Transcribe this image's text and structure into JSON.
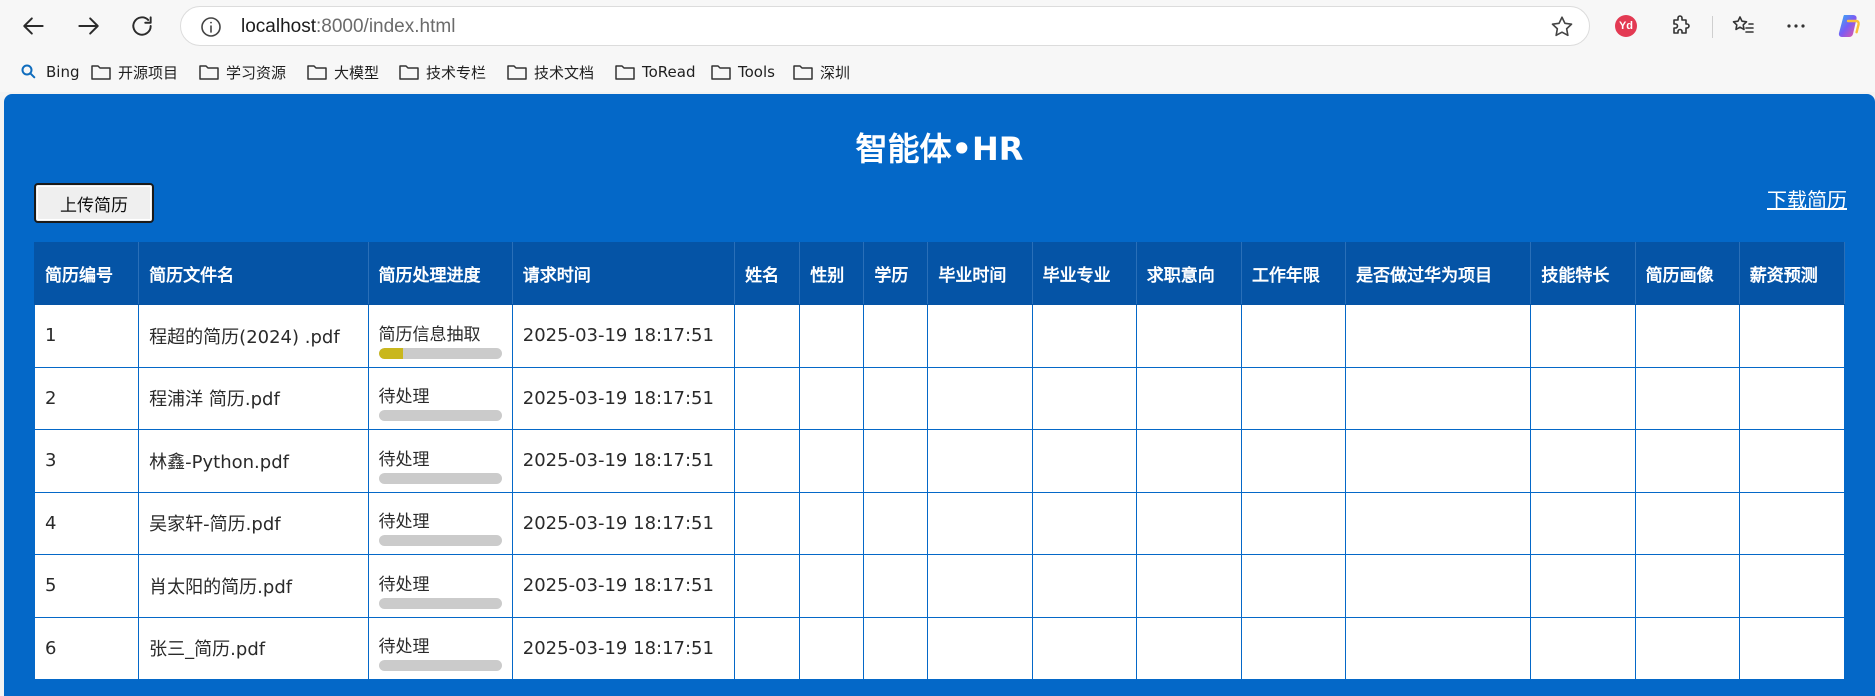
{
  "browser": {
    "url_host": "localhost",
    "url_rest": ":8000/index.html",
    "profile_initials": "Yd",
    "bookmarks": [
      {
        "label": "Bing",
        "icon": "search-icon"
      },
      {
        "label": "开源项目",
        "icon": "folder-icon"
      },
      {
        "label": "学习资源",
        "icon": "folder-icon"
      },
      {
        "label": "大模型",
        "icon": "folder-icon"
      },
      {
        "label": "技术专栏",
        "icon": "folder-icon"
      },
      {
        "label": "技术文档",
        "icon": "folder-icon"
      },
      {
        "label": "ToRead",
        "icon": "folder-icon"
      },
      {
        "label": "Tools",
        "icon": "folder-icon"
      },
      {
        "label": "深圳",
        "icon": "folder-icon"
      }
    ]
  },
  "app": {
    "title": "智能体•HR",
    "upload_label": "上传简历",
    "download_label": "下载简历",
    "accent_color": "#0468c8",
    "header_color": "#0554a6",
    "progress_color": "#c9b71d"
  },
  "table": {
    "columns": [
      "简历编号",
      "简历文件名",
      "简历处理进度",
      "请求时间",
      "姓名",
      "性别",
      "学历",
      "毕业时间",
      "毕业专业",
      "求职意向",
      "工作年限",
      "是否做过华为项目",
      "技能特长",
      "简历画像",
      "薪资预测"
    ],
    "rows": [
      {
        "id": "1",
        "filename": "程超的简历(2024) .pdf",
        "status": "简历信息抽取",
        "progress": 0.2,
        "time": "2025-03-19 18:17:51"
      },
      {
        "id": "2",
        "filename": "程浦洋 简历.pdf",
        "status": "待处理",
        "progress": 0,
        "time": "2025-03-19 18:17:51"
      },
      {
        "id": "3",
        "filename": "林鑫-Python.pdf",
        "status": "待处理",
        "progress": 0,
        "time": "2025-03-19 18:17:51"
      },
      {
        "id": "4",
        "filename": "吴家轩-简历.pdf",
        "status": "待处理",
        "progress": 0,
        "time": "2025-03-19 18:17:51"
      },
      {
        "id": "5",
        "filename": "肖太阳的简历.pdf",
        "status": "待处理",
        "progress": 0,
        "time": "2025-03-19 18:17:51"
      },
      {
        "id": "6",
        "filename": "张三_简历.pdf",
        "status": "待处理",
        "progress": 0,
        "time": "2025-03-19 18:17:51"
      }
    ]
  }
}
